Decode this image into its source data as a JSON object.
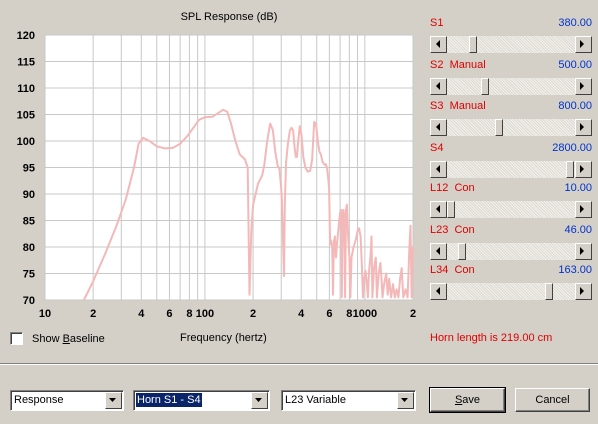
{
  "chart_data": {
    "type": "line",
    "title": "SPL Response (dB)",
    "xlabel": "Frequency (hertz)",
    "ylabel": "",
    "x_scale": "log",
    "xlim": [
      10,
      2000
    ],
    "ylim": [
      70,
      120
    ],
    "y_ticks": [
      "70",
      "75",
      "80",
      "85",
      "90",
      "95",
      "100",
      "105",
      "110",
      "115",
      "120"
    ],
    "x_ticks": [
      {
        "value": 10,
        "label": "10"
      },
      {
        "value": 20,
        "label": "2"
      },
      {
        "value": 40,
        "label": "4"
      },
      {
        "value": 60,
        "label": "6"
      },
      {
        "value": 80,
        "label": "8"
      },
      {
        "value": 100,
        "label": "100"
      },
      {
        "value": 200,
        "label": "2"
      },
      {
        "value": 400,
        "label": "4"
      },
      {
        "value": 600,
        "label": "6"
      },
      {
        "value": 800,
        "label": "8"
      },
      {
        "value": 1000,
        "label": "1000"
      },
      {
        "value": 2000,
        "label": "2"
      }
    ],
    "grid": true,
    "series": [
      {
        "color": "#f4b8b8",
        "points": [
          [
            17.5,
            70
          ],
          [
            20,
            73.5
          ],
          [
            24,
            79
          ],
          [
            28,
            84
          ],
          [
            32,
            89
          ],
          [
            36,
            95
          ],
          [
            38.5,
            99.5
          ],
          [
            41,
            100.6
          ],
          [
            45,
            100
          ],
          [
            50,
            99
          ],
          [
            56,
            98.6
          ],
          [
            63,
            98.7
          ],
          [
            70,
            99.5
          ],
          [
            78,
            101
          ],
          [
            86,
            102.8
          ],
          [
            92,
            104
          ],
          [
            100,
            104.5
          ],
          [
            112,
            104.6
          ],
          [
            120,
            105.2
          ],
          [
            130,
            105.9
          ],
          [
            138,
            105.5
          ],
          [
            145,
            103.5
          ],
          [
            155,
            100
          ],
          [
            165,
            97.5
          ],
          [
            178,
            96.5
          ],
          [
            185,
            95
          ],
          [
            190,
            71
          ],
          [
            195,
            83
          ],
          [
            200,
            88
          ],
          [
            215,
            92
          ],
          [
            228,
            93.5
          ],
          [
            235,
            95.5
          ],
          [
            245,
            100
          ],
          [
            256,
            103.3
          ],
          [
            266,
            102
          ],
          [
            275,
            98
          ],
          [
            285,
            95.3
          ],
          [
            292,
            94.8
          ],
          [
            298,
            92
          ],
          [
            303,
            89
          ],
          [
            312,
            74.5
          ],
          [
            316,
            88
          ],
          [
            322,
            96
          ],
          [
            330,
            99.5
          ],
          [
            340,
            102
          ],
          [
            348,
            102.5
          ],
          [
            356,
            102
          ],
          [
            363,
            99
          ],
          [
            370,
            97
          ],
          [
            376,
            97
          ],
          [
            383,
            100
          ],
          [
            392,
            102.8
          ],
          [
            402,
            101
          ],
          [
            412,
            97
          ],
          [
            425,
            95
          ],
          [
            440,
            94.2
          ],
          [
            455,
            94.4
          ],
          [
            468,
            96.4
          ],
          [
            482,
            103.6
          ],
          [
            495,
            103.2
          ],
          [
            508,
            100
          ],
          [
            520,
            98
          ],
          [
            530,
            97.5
          ],
          [
            545,
            96
          ],
          [
            560,
            95.5
          ],
          [
            570,
            95.6
          ],
          [
            580,
            95
          ],
          [
            590,
            93
          ],
          [
            598,
            91
          ],
          [
            605,
            82
          ],
          [
            610,
            80.5
          ],
          [
            616,
            81.2
          ],
          [
            625,
            80
          ],
          [
            632,
            71
          ],
          [
            640,
            81
          ],
          [
            650,
            82
          ],
          [
            660,
            78
          ],
          [
            672,
            81
          ],
          [
            686,
            84
          ],
          [
            700,
            86.5
          ],
          [
            712,
            87
          ],
          [
            718,
            70.5
          ],
          [
            726,
            85
          ],
          [
            735,
            87
          ],
          [
            742,
            86
          ],
          [
            752,
            70.5
          ],
          [
            762,
            87
          ],
          [
            772,
            88
          ],
          [
            786,
            82
          ],
          [
            800,
            78
          ],
          [
            812,
            70.5
          ],
          [
            825,
            78
          ],
          [
            850,
            80
          ],
          [
            880,
            81.5
          ],
          [
            900,
            83
          ],
          [
            920,
            83.5
          ],
          [
            940,
            82
          ],
          [
            960,
            76
          ],
          [
            972,
            70.5
          ],
          [
            990,
            74
          ],
          [
            1010,
            75.5
          ],
          [
            1030,
            73
          ],
          [
            1045,
            70.5
          ],
          [
            1060,
            75
          ],
          [
            1090,
            79
          ],
          [
            1100,
            82
          ],
          [
            1115,
            70.5
          ],
          [
            1140,
            76
          ],
          [
            1170,
            78
          ],
          [
            1190,
            70.5
          ],
          [
            1220,
            75
          ],
          [
            1250,
            77
          ],
          [
            1270,
            74
          ],
          [
            1290,
            70.5
          ],
          [
            1320,
            73
          ],
          [
            1360,
            75
          ],
          [
            1390,
            71
          ],
          [
            1420,
            74
          ],
          [
            1460,
            70.5
          ],
          [
            1500,
            73
          ],
          [
            1540,
            70.5
          ],
          [
            1580,
            72
          ],
          [
            1620,
            70.5
          ],
          [
            1660,
            74
          ],
          [
            1700,
            76
          ],
          [
            1740,
            70.5
          ],
          [
            1800,
            72
          ],
          [
            1850,
            70.5
          ],
          [
            1900,
            80
          ],
          [
            1930,
            84
          ],
          [
            1960,
            70.5
          ],
          [
            1990,
            80
          ]
        ]
      }
    ]
  },
  "controls": {
    "show_baseline_label": "Show Baseline",
    "show_baseline_checked": false,
    "horn_length": "Horn length is 219.00 cm"
  },
  "sliders": [
    {
      "label": "S1",
      "value": "380.00",
      "position": 0.18
    },
    {
      "label": "S2  Manual",
      "value": "500.00",
      "position": 0.28
    },
    {
      "label": "S3  Manual",
      "value": "800.00",
      "position": 0.4
    },
    {
      "label": "S4",
      "value": "2800.00",
      "position": 0.99
    },
    {
      "label": "L12  Con",
      "value": "10.00",
      "position": 0.0
    },
    {
      "label": "L23  Con",
      "value": "46.00",
      "position": 0.09
    },
    {
      "label": "L34  Con",
      "value": "163.00",
      "position": 0.82
    }
  ],
  "footer": {
    "view_select": "Response",
    "horn_select": "Horn S1 - S4",
    "variable_select": "L23 Variable",
    "save_label": "Save",
    "cancel_label": "Cancel"
  },
  "icons": {
    "left": "scroll-left-arrow-icon",
    "right": "scroll-right-arrow-icon",
    "dropdown": "dropdown-arrow-icon"
  }
}
